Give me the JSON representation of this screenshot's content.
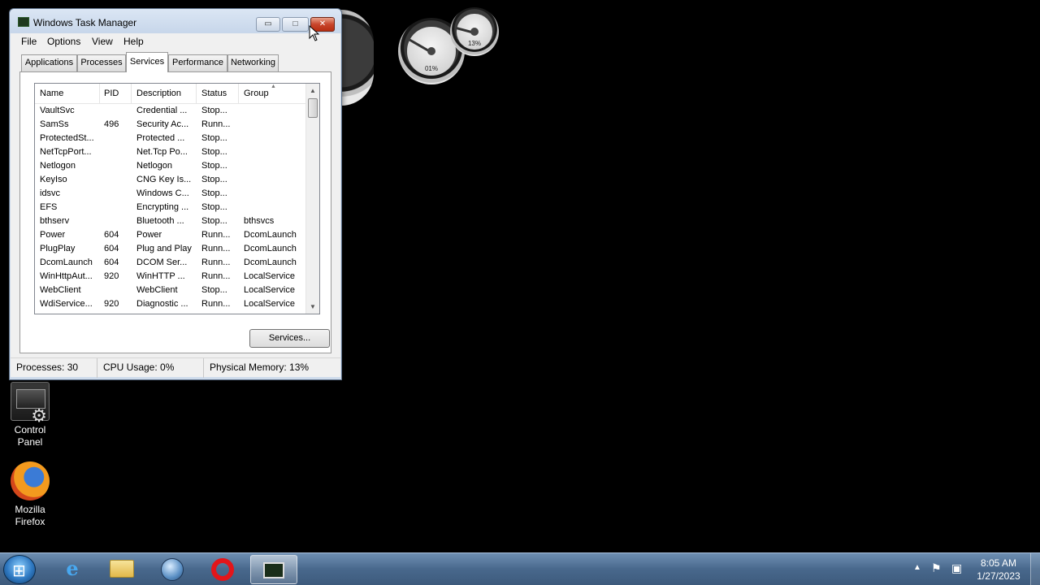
{
  "desktop": {
    "icons": [
      {
        "label_line1": "Control",
        "label_line2": "Panel",
        "icon": "control-panel-icon"
      },
      {
        "label_line1": "Mozilla",
        "label_line2": "Firefox",
        "icon": "firefox-icon"
      }
    ],
    "gadget": {
      "cpu_value": "01%",
      "memory_value": "13%"
    }
  },
  "window": {
    "title": "Windows Task Manager",
    "minimize_label": "▭",
    "maximize_label": "□",
    "close_label": "✕",
    "menu": [
      "File",
      "Options",
      "View",
      "Help"
    ],
    "tabs": [
      "Applications",
      "Processes",
      "Services",
      "Performance",
      "Networking"
    ],
    "active_tab": "Services",
    "columns": [
      "Name",
      "PID",
      "Description",
      "Status",
      "Group"
    ],
    "rows": [
      {
        "name": "VaultSvc",
        "pid": "",
        "description": "Credential ...",
        "status": "Stop...",
        "group": ""
      },
      {
        "name": "SamSs",
        "pid": "496",
        "description": "Security Ac...",
        "status": "Runn...",
        "group": ""
      },
      {
        "name": "ProtectedSt...",
        "pid": "",
        "description": "Protected ...",
        "status": "Stop...",
        "group": ""
      },
      {
        "name": "NetTcpPort...",
        "pid": "",
        "description": "Net.Tcp Po...",
        "status": "Stop...",
        "group": ""
      },
      {
        "name": "Netlogon",
        "pid": "",
        "description": "Netlogon",
        "status": "Stop...",
        "group": ""
      },
      {
        "name": "KeyIso",
        "pid": "",
        "description": "CNG Key Is...",
        "status": "Stop...",
        "group": ""
      },
      {
        "name": "idsvc",
        "pid": "",
        "description": "Windows C...",
        "status": "Stop...",
        "group": ""
      },
      {
        "name": "EFS",
        "pid": "",
        "description": "Encrypting ...",
        "status": "Stop...",
        "group": ""
      },
      {
        "name": "bthserv",
        "pid": "",
        "description": "Bluetooth ...",
        "status": "Stop...",
        "group": "bthsvcs"
      },
      {
        "name": "Power",
        "pid": "604",
        "description": "Power",
        "status": "Runn...",
        "group": "DcomLaunch"
      },
      {
        "name": "PlugPlay",
        "pid": "604",
        "description": "Plug and Play",
        "status": "Runn...",
        "group": "DcomLaunch"
      },
      {
        "name": "DcomLaunch",
        "pid": "604",
        "description": "DCOM Ser...",
        "status": "Runn...",
        "group": "DcomLaunch"
      },
      {
        "name": "WinHttpAut...",
        "pid": "920",
        "description": "WinHTTP ...",
        "status": "Runn...",
        "group": "LocalService"
      },
      {
        "name": "WebClient",
        "pid": "",
        "description": "WebClient",
        "status": "Stop...",
        "group": "LocalService"
      },
      {
        "name": "WdiService...",
        "pid": "920",
        "description": "Diagnostic ...",
        "status": "Runn...",
        "group": "LocalService"
      }
    ],
    "services_button": "Services...",
    "status": {
      "processes": "Processes: 30",
      "cpu": "CPU Usage: 0%",
      "memory": "Physical Memory: 13%"
    }
  },
  "taskbar": {
    "items": [
      "internet-explorer-icon",
      "windows-explorer-icon",
      "globe-icon",
      "opera-icon",
      "task-manager-icon"
    ],
    "clock_time": "8:05 AM",
    "clock_date": "1/27/2023"
  }
}
